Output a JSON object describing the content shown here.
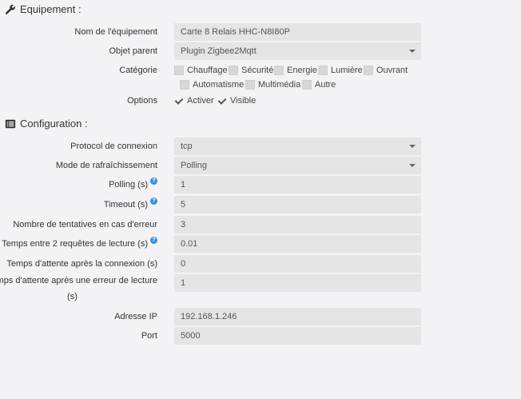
{
  "equipment": {
    "title": "Equipement :",
    "name_label": "Nom de l'équipement",
    "name_value": "Carte 8 Relais HHC-N8I80P",
    "parent_label": "Objet parent",
    "parent_value": "Plugin Zigbee2Mqtt",
    "category_label": "Catégorie",
    "categories": [
      {
        "label": "Chauffage",
        "checked": false
      },
      {
        "label": "Sécurité",
        "checked": false
      },
      {
        "label": "Energie",
        "checked": false
      },
      {
        "label": "Lumière",
        "checked": false
      },
      {
        "label": "Ouvrant",
        "checked": false
      },
      {
        "label": "Automatisme",
        "checked": false
      },
      {
        "label": "Multimédia",
        "checked": false
      },
      {
        "label": "Autre",
        "checked": false
      }
    ],
    "options_label": "Options",
    "options": [
      {
        "label": "Activer",
        "checked": true
      },
      {
        "label": "Visible",
        "checked": true
      }
    ]
  },
  "configuration": {
    "title": "Configuration :",
    "fields": [
      {
        "label": "Protocol de connexion",
        "value": "tcp",
        "type": "select",
        "help": false
      },
      {
        "label": "Mode de rafraîchissement",
        "value": "Polling",
        "type": "select",
        "help": false
      },
      {
        "label": "Polling (s)",
        "value": "1",
        "type": "input",
        "help": true
      },
      {
        "label": "Timeout (s)",
        "value": "5",
        "type": "input",
        "help": true
      },
      {
        "label": "Nombre de tentatives en cas d'erreur",
        "value": "3",
        "type": "input",
        "help": false
      },
      {
        "label": "Temps entre 2 requêtes de lecture (s)",
        "value": "0.01",
        "type": "input",
        "help": true
      },
      {
        "label": "Temps d'attente après la connexion (s)",
        "value": "0",
        "type": "input",
        "help": false
      },
      {
        "label_line1": "Temps d'attente après une erreur de lecture",
        "label_line2": "(s)",
        "value": "1",
        "type": "input",
        "help": false
      },
      {
        "label": "Adresse IP",
        "value": "192.168.1.246",
        "type": "input",
        "help": false
      },
      {
        "label": "Port",
        "value": "5000",
        "type": "input",
        "help": false
      }
    ]
  },
  "help_glyph": "?",
  "icons": {
    "equipment": "wrench-icon",
    "configuration": "list-icon"
  }
}
